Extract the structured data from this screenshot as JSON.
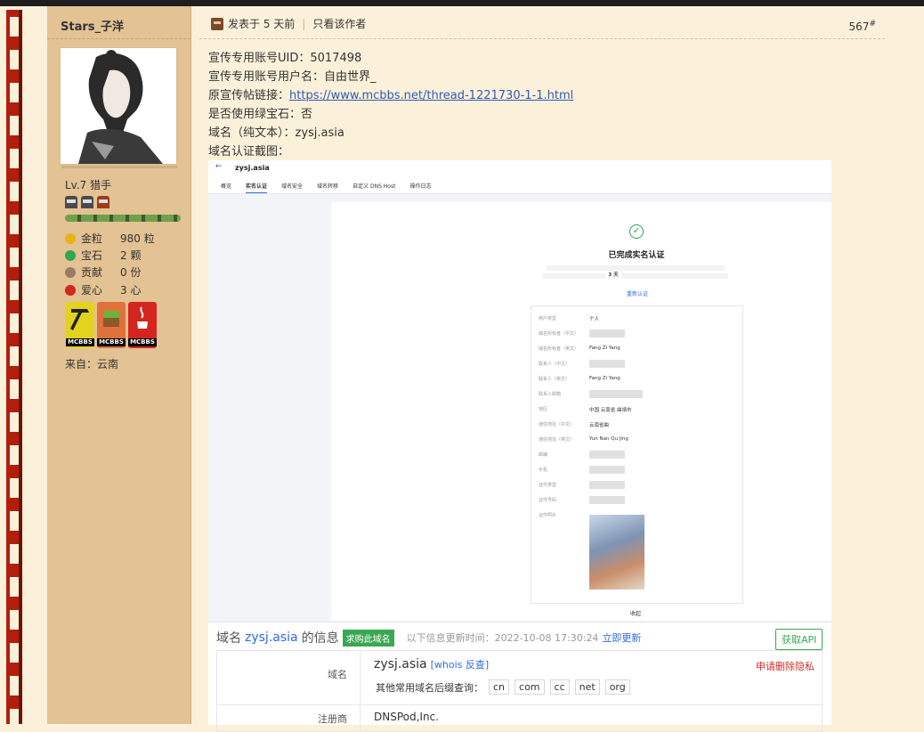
{
  "user": {
    "name": "Stars_子洋",
    "level": "Lv.7 猎手",
    "location": "来自：云南",
    "stats": [
      {
        "label": "金粒",
        "value": "980 粒",
        "icon": "gold-nugget-icon",
        "color": "#e7b31b"
      },
      {
        "label": "宝石",
        "value": "2 颗",
        "icon": "emerald-icon",
        "color": "#31a84d"
      },
      {
        "label": "贡献",
        "value": "0 份",
        "icon": "contribution-icon",
        "color": "#9b7c6b"
      },
      {
        "label": "爱心",
        "value": "3 心",
        "icon": "apple-heart-icon",
        "color": "#d3281d"
      }
    ],
    "medals": [
      {
        "label": "MCBBS",
        "icon": "golden-pickaxe-medal-icon",
        "color": "#e3d21e"
      },
      {
        "label": "MCBBS",
        "icon": "grass-block-medal-icon",
        "color": "#e0713a"
      },
      {
        "label": "MCBBS",
        "icon": "java-medal-icon",
        "color": "#d4251e"
      }
    ]
  },
  "post": {
    "posted": "发表于 5 天前",
    "only_author": "只看该作者",
    "floor": "567",
    "floor_mark": "#",
    "lines": [
      {
        "text": "宣传专用账号UID：5017498"
      },
      {
        "text": "宣传专用账号用户名：自由世界_"
      },
      {
        "prefix": "原宣传帖链接：",
        "link": "https://www.mcbbs.net/thread-1221730-1-1.html"
      },
      {
        "text": "是否使用绿宝石：否"
      },
      {
        "text": "域名（纯文本）：zysj.asia"
      },
      {
        "text": "域名认证截图："
      }
    ]
  },
  "screenshot": {
    "title": "zysj.asia",
    "tabs": [
      "概览",
      "实名认证",
      "域名安全",
      "域名转移",
      "自定义 DNS Host",
      "操作日志"
    ],
    "heading": "已完成实名认证",
    "desc_days": "3 天",
    "relink": "重新认证",
    "rows": [
      {
        "label": "用户类型",
        "value": "个人"
      },
      {
        "label": "域名所有者（中文）",
        "value": ""
      },
      {
        "label": "域名所有者（英文）",
        "value": "Fang Zi Yang"
      },
      {
        "label": "联系人（中文）",
        "value": ""
      },
      {
        "label": "联系人（英文）",
        "value": "Fang Zi Yang"
      },
      {
        "label": "联系人邮箱",
        "value": ""
      },
      {
        "label": "地区",
        "value": "中国 云南省 曲靖市"
      },
      {
        "label": "通信地址（中文）",
        "value": "云南省曲"
      },
      {
        "label": "通信地址（英文）",
        "value": "Yun Nan Qu Jing"
      },
      {
        "label": "邮编",
        "value": ""
      },
      {
        "label": "手机",
        "value": ""
      },
      {
        "label": "证件类型",
        "value": ""
      },
      {
        "label": "证件号码",
        "value": ""
      },
      {
        "label": "证件照片",
        "value": ""
      }
    ],
    "footer_btn": "收起"
  },
  "whois": {
    "title_prefix": "域名",
    "domain": "zysj.asia",
    "title_suffix": "的信息",
    "buy": "求购此域名",
    "updated": "以下信息更新时间：2022-10-08 17:30:24",
    "refresh": "立即更新",
    "api": "获取API",
    "label_domain": "域名",
    "domain_value": "zysj.asia",
    "whois_link": "[whois 反查]",
    "privacy": "申请删除隐私",
    "suffix_label": "其他常用域名后缀查询：",
    "suffixes": [
      "cn",
      "com",
      "cc",
      "net",
      "org"
    ],
    "label_registrar": "注册商",
    "registrar": "DNSPod,Inc."
  }
}
